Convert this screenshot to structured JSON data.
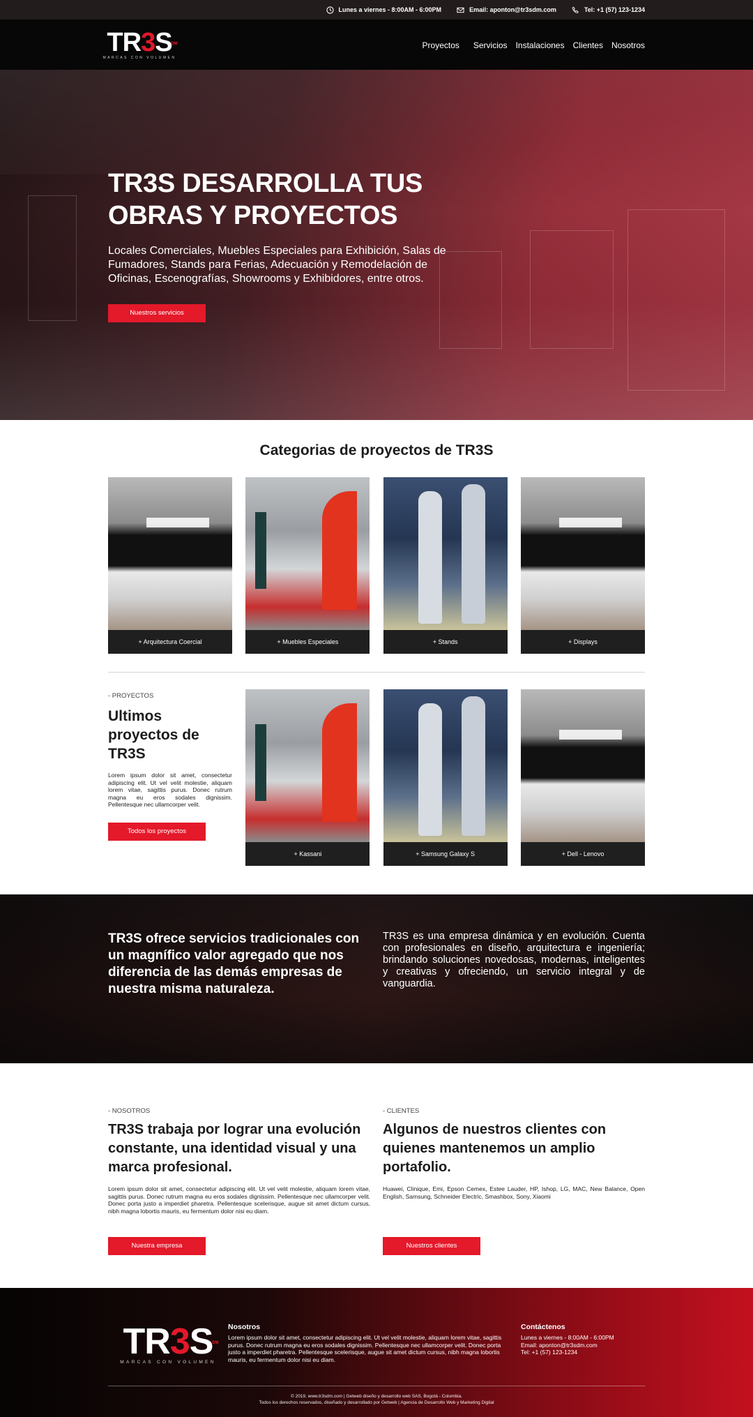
{
  "topbar": {
    "hours": "Lunes a viernes - 8:00AM - 6:00PM",
    "email": "Email: aponton@tr3sdm.com",
    "phone": "Tel: +1 (57) 123-1234"
  },
  "brand": {
    "logo_left": "TR",
    "logo_mid": "3",
    "logo_right": "S",
    "logo_sup": "DM",
    "tagline": "MARCAS CON VOLUMEN",
    "accent": "#e4192a"
  },
  "nav": {
    "items": [
      "Proyectos",
      "Servicios",
      "Instalaciones",
      "Clientes",
      "Nosotros"
    ]
  },
  "hero": {
    "title_line1": "TR3S DESARROLLA TUS",
    "title_line2": "OBRAS Y PROYECTOS",
    "text": "Locales Comerciales, Muebles Especiales para Exhibición, Salas de Fumadores, Stands para Ferias, Adecuación y Remodelación de Oficinas, Escenografías, Showrooms y  Exhibidores, entre otros.",
    "button": "Nuestros servicios"
  },
  "categories": {
    "title": "Categorias de proyectos de TR3S",
    "items": [
      "+ Arquitectura Coercial",
      "+ Muebles Especiales",
      "+ Stands",
      "+ Displays"
    ]
  },
  "projects": {
    "kicker": "- PROYECTOS",
    "title": "Ultimos proyectos de TR3S",
    "body": "Lorem ipsum dolor sit amet, consectetur adipiscing elit. Ut vel velit molestie, aliquam lorem vitae, sagittis purus. Donec rutrum magna eu eros sodales dignissim. Pellentesque nec ullamcorper velit.",
    "button": "Todos los proyectos",
    "items": [
      "+ Kassani",
      "+ Samsung Galaxy S",
      "+ Dell - Lenovo"
    ]
  },
  "band": {
    "left": "TR3S  ofrece servicios tradicionales con un magnífico valor agregado que nos diferencia de las demás empresas de nuestra misma naturaleza.",
    "right": "TR3S es una empresa dinámica y en evolución. Cuenta con profesionales en diseño, arquitectura e ingeniería; brindando soluciones novedosas, modernas, inteligentes y creativas y ofreciendo, un servicio integral y de vanguardia."
  },
  "about": {
    "kicker": "- NOSOTROS",
    "title": "TR3S trabaja por lograr una evolución constante, una identidad visual y una marca profesional.",
    "body": "Lorem ipsum dolor sit amet, consectetur adipiscing elit. Ut vel velit molestie, aliquam lorem vitae, sagittis purus. Donec rutrum magna eu eros sodales dignissim. Pellentesque nec ullamcorper velit. Donec porta justo a imperdiet pharetra. Pellentesque scelerisque, augue sit amet dictum cursus, nibh magna lobortis mauris, eu fermentum dolor nisi eu diam.",
    "button": "Nuestra empresa"
  },
  "clients": {
    "kicker": "- CLIENTES",
    "title": "Algunos de nuestros clientes con quienes mantenemos un amplio portafolio.",
    "body": "Huawei, Clinique, Emi, Epson Cemex, Estee Lauder, HP, Ishop, LG, MAC, New Balance, Open English, Samsung, Schneider Electric, Smashbox, Sony, Xiaomi",
    "button": "Nuestros clientes"
  },
  "footer": {
    "about_heading": "Nosotros",
    "about_text": "Lorem ipsum dolor sit amet, consectetur adipiscing elit. Ut vel velit molestie, aliquam lorem vitae, sagittis purus. Donec rutrum magna eu eros sodales dignissim. Pellentesque nec ullamcorper velit. Donec porta justo a imperdiet pharetra. Pellentesque scelerisque, augue sit amet dictum cursus, nibh magna lobortis mauris, eu fermentum dolor nisi eu diam.",
    "contact_heading": "Contáctenos",
    "contact_hours": "Lunes a viernes - 8:00AM - 6:00PM",
    "contact_email": "Email: aponton@tr3sdm.com",
    "contact_phone": "Tel: +1 (57) 123-1234",
    "copy_line1": "© 2019, www.tr3sdm.com | Getweb diseño y desarrollo web SAS, Bogotá - Colombia.",
    "copy_line2": "Todos los derechos reservados, diseñado y desarrollado por Getweb | Agencia de Desarrollo Web y Marketing Digital"
  }
}
